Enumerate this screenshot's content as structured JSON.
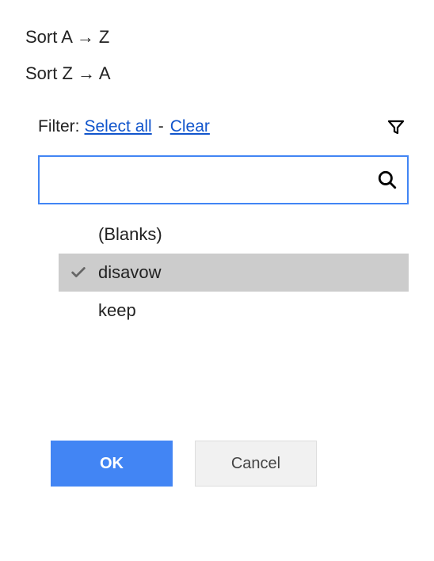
{
  "sort": {
    "az_label": "Sort A → Z",
    "za_label": "Sort Z → A"
  },
  "filter": {
    "label": "Filter:",
    "select_all_label": "Select all",
    "separator": "-",
    "clear_label": "Clear",
    "search_placeholder": ""
  },
  "options": [
    {
      "label": "(Blanks)",
      "selected": false
    },
    {
      "label": "disavow",
      "selected": true
    },
    {
      "label": "keep",
      "selected": false
    }
  ],
  "buttons": {
    "ok_label": "OK",
    "cancel_label": "Cancel"
  }
}
